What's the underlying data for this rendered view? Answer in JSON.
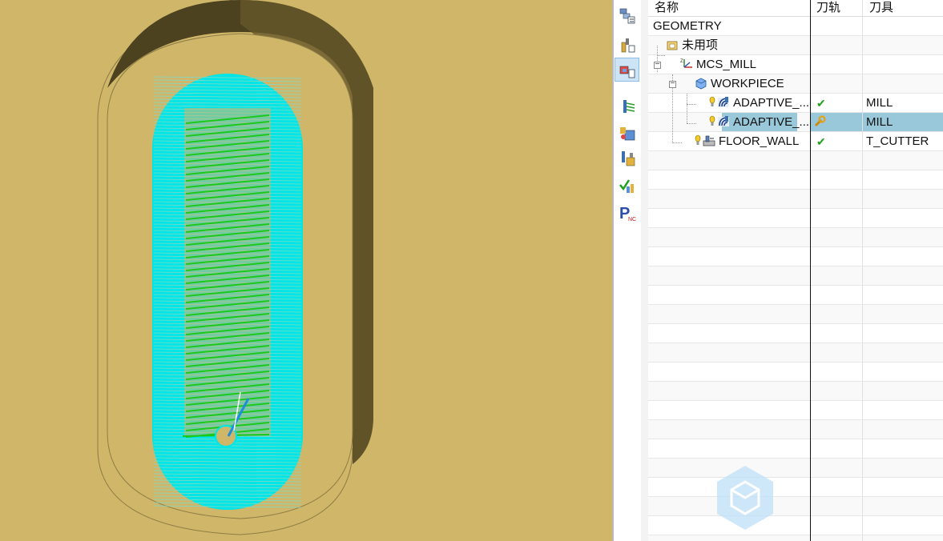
{
  "colors": {
    "background": "#cfb669",
    "toolpath_outer": "#00e5e5",
    "toolpath_inner": "#1bc81b",
    "tool": "#1e8de0",
    "selection": "#98c8d9",
    "check": "#1aa01a"
  },
  "resource_bar": {
    "icons": [
      "program-order-view-icon",
      "machine-tool-view-icon",
      "geometry-view-icon",
      "generate-toolpath-icon",
      "verify-toolpath-icon",
      "simulate-icon",
      "toolpath-check-icon",
      "post-process-icon"
    ]
  },
  "navigator": {
    "headers": {
      "name": "名称",
      "toolpath": "刀轨",
      "tool": "刀具"
    },
    "rows": [
      {
        "name": "GEOMETRY",
        "toolpath": "",
        "tool": "",
        "icon": ""
      },
      {
        "name": "未用项",
        "toolpath": "",
        "tool": "",
        "icon": "folder-icon"
      },
      {
        "name": "MCS_MILL",
        "toolpath": "",
        "tool": "",
        "icon": "mcs-icon"
      },
      {
        "name": "WORKPIECE",
        "toolpath": "",
        "tool": "",
        "icon": "workpiece-icon"
      },
      {
        "name": "ADAPTIVE_...",
        "toolpath": "✔",
        "tool": "MILL",
        "icon": "adaptive-milling-icon",
        "status": "complete"
      },
      {
        "name": "ADAPTIVE_...",
        "toolpath": "",
        "tool": "MILL",
        "icon": "adaptive-milling-icon",
        "status": "regenerate",
        "selected": true
      },
      {
        "name": "FLOOR_WALL",
        "toolpath": "✔",
        "tool": "T_CUTTER",
        "icon": "floor-wall-icon",
        "status": "complete"
      }
    ]
  }
}
